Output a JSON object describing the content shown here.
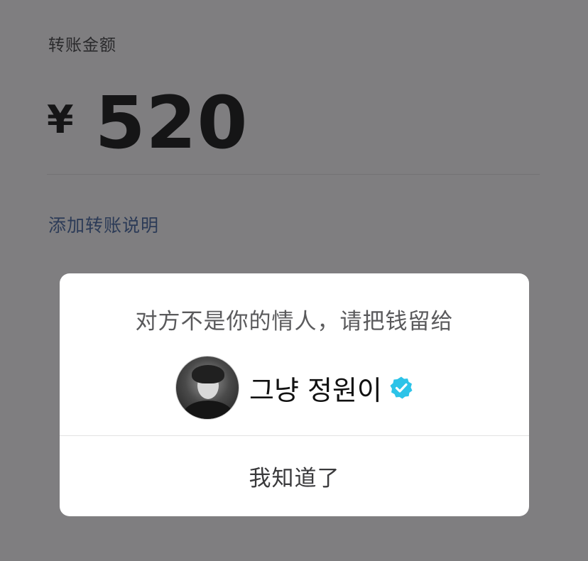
{
  "transfer": {
    "amount_label": "转账金额",
    "currency_symbol": "¥",
    "amount": "520",
    "add_note_label": "添加转账说明"
  },
  "dialog": {
    "message": "对方不是你的情人，请把钱留给",
    "recipient_name": "그냥 정원이",
    "verified_icon": "verified-badge-icon",
    "acknowledge_label": "我知道了"
  },
  "colors": {
    "overlay_background": "#7f7e80",
    "dialog_background": "#ffffff",
    "link_color": "#2c3b57",
    "verified_color": "#2cc3e8"
  }
}
